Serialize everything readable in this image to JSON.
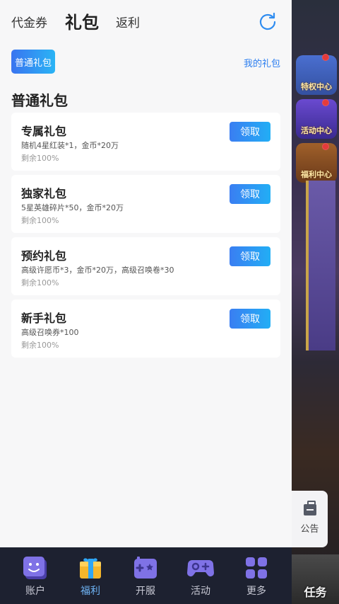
{
  "header": {
    "tabs": [
      {
        "label": "代金券",
        "active": false
      },
      {
        "label": "礼包",
        "active": true
      },
      {
        "label": "返利",
        "active": false
      }
    ]
  },
  "filter": {
    "chip_label": "普通礼包",
    "my_gift_link": "我的礼包"
  },
  "section_title": "普通礼包",
  "gifts": [
    {
      "name": "专属礼包",
      "content": "随机4星红装*1，金币*20万",
      "remaining": "剩余100%",
      "action": "领取"
    },
    {
      "name": "独家礼包",
      "content": "5星英雄碎片*50，金币*20万",
      "remaining": "剩余100%",
      "action": "领取"
    },
    {
      "name": "预约礼包",
      "content": "高级许愿币*3，金币*20万，高级召唤卷*30",
      "remaining": "剩余100%",
      "action": "领取"
    },
    {
      "name": "新手礼包",
      "content": "高级召唤券*100",
      "remaining": "剩余100%",
      "action": "领取"
    }
  ],
  "notice": {
    "label": "公告"
  },
  "background_game": {
    "icons": [
      "特权中心",
      "活动中心",
      "福利中心"
    ],
    "task_label": "任务"
  },
  "bottom_nav": [
    {
      "label": "账户",
      "icon": "account-face-icon",
      "active": false
    },
    {
      "label": "福利",
      "icon": "gift-box-icon",
      "active": true
    },
    {
      "label": "开服",
      "icon": "gamepad-icon",
      "active": false
    },
    {
      "label": "活动",
      "icon": "controller-plus-icon",
      "active": false
    },
    {
      "label": "更多",
      "icon": "grid-more-icon",
      "active": false
    }
  ],
  "colors": {
    "accent_gradient_start": "#3a74f0",
    "accent_gradient_end": "#2ab4f5",
    "link": "#2a7df0",
    "nav_active": "#6fb4f5",
    "nav_bg": "#1d2130"
  }
}
